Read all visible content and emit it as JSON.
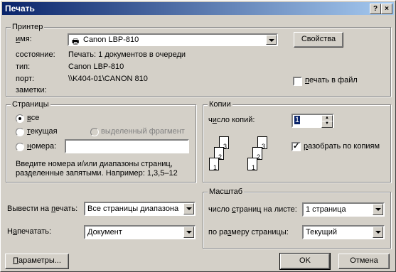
{
  "window": {
    "title": "Печать",
    "help": "?",
    "close": "×"
  },
  "printer": {
    "group_label": "Принтер",
    "name_label_u": "и",
    "name_label_rest": "мя:",
    "name_value": "Canon LBP-810",
    "properties_button": "Свойства",
    "status_label": "состояние:",
    "status_value": "Печать: 1 документов в очереди",
    "type_label": "тип:",
    "type_value": "Canon LBP-810",
    "port_label": "порт:",
    "port_value": "\\\\K404-01\\CANON 810",
    "notes_label": "заметки:",
    "print_to_file_u": "п",
    "print_to_file_rest": "ечать в файл",
    "print_to_file_checked": false
  },
  "pages": {
    "group_label": "Страницы",
    "all_u": "в",
    "all_rest": "се",
    "current_u": "т",
    "current_rest": "екущая",
    "selection": "выделенный фрагмент",
    "numbers_u": "н",
    "numbers_rest": "омера:",
    "numbers_value": "",
    "hint_line1": "Введите номера и/или диапазоны страниц,",
    "hint_line2": "разделенные запятыми. Например: 1,3,5–12",
    "selected": "all"
  },
  "copies": {
    "group_label": "Копии",
    "count_label_pre": "ч",
    "count_label_u": "и",
    "count_label_rest": "сло копий:",
    "count_value": "1",
    "collate_u": "р",
    "collate_rest": "азобрать по копиям",
    "collate_checked": true,
    "page_numbers": [
      "3",
      "2",
      "1"
    ]
  },
  "print_what": {
    "label_pre": "Вывести на ",
    "label_u": "п",
    "label_rest": "ечать:",
    "value": "Все страницы диапазона"
  },
  "print_type": {
    "label_pre": "Н",
    "label_u": "а",
    "label_rest": "печатать:",
    "value": "Документ"
  },
  "zoom": {
    "group_label": "Масштаб",
    "pages_label_pre": "число ",
    "pages_label_u": "с",
    "pages_label_rest": "траниц на листе:",
    "pages_value": "1 страница",
    "scale_label_pre": "по ра",
    "scale_label_u": "з",
    "scale_label_rest": "меру страницы:",
    "scale_value": "Текущий"
  },
  "footer": {
    "options_u": "П",
    "options_rest": "араметры...",
    "ok": "OK",
    "cancel": "Отмена"
  }
}
